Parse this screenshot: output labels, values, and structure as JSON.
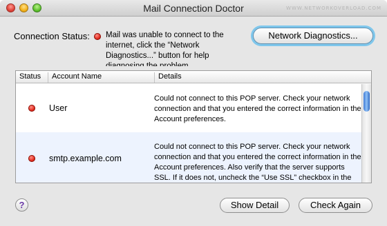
{
  "window": {
    "title": "Mail Connection Doctor",
    "watermark": "WWW.NETWORKOVERLOAD.COM"
  },
  "connection": {
    "label": "Connection Status:",
    "status_color": "#e3281b",
    "message": "Mail was unable to connect to the internet, click the “Network Diagnostics...” button for help diagnosing the problem."
  },
  "buttons": {
    "network_diagnostics": "Network Diagnostics...",
    "show_detail": "Show Detail",
    "check_again": "Check Again",
    "help": "?"
  },
  "table": {
    "headers": [
      "Status",
      "Account Name",
      "Details"
    ],
    "rows": [
      {
        "status": "red",
        "account": "User",
        "details": "Could not connect to this POP server. Check your network connection and that you entered the correct information in the Account preferences."
      },
      {
        "status": "red",
        "account": "smtp.example.com",
        "details": "Could not connect to this POP server. Check your network connection and that you entered the correct information in the Account preferences. Also verify that the server supports SSL. If it does not, uncheck the “Use SSL” checkbox in the Advanced tab of Account"
      }
    ]
  }
}
